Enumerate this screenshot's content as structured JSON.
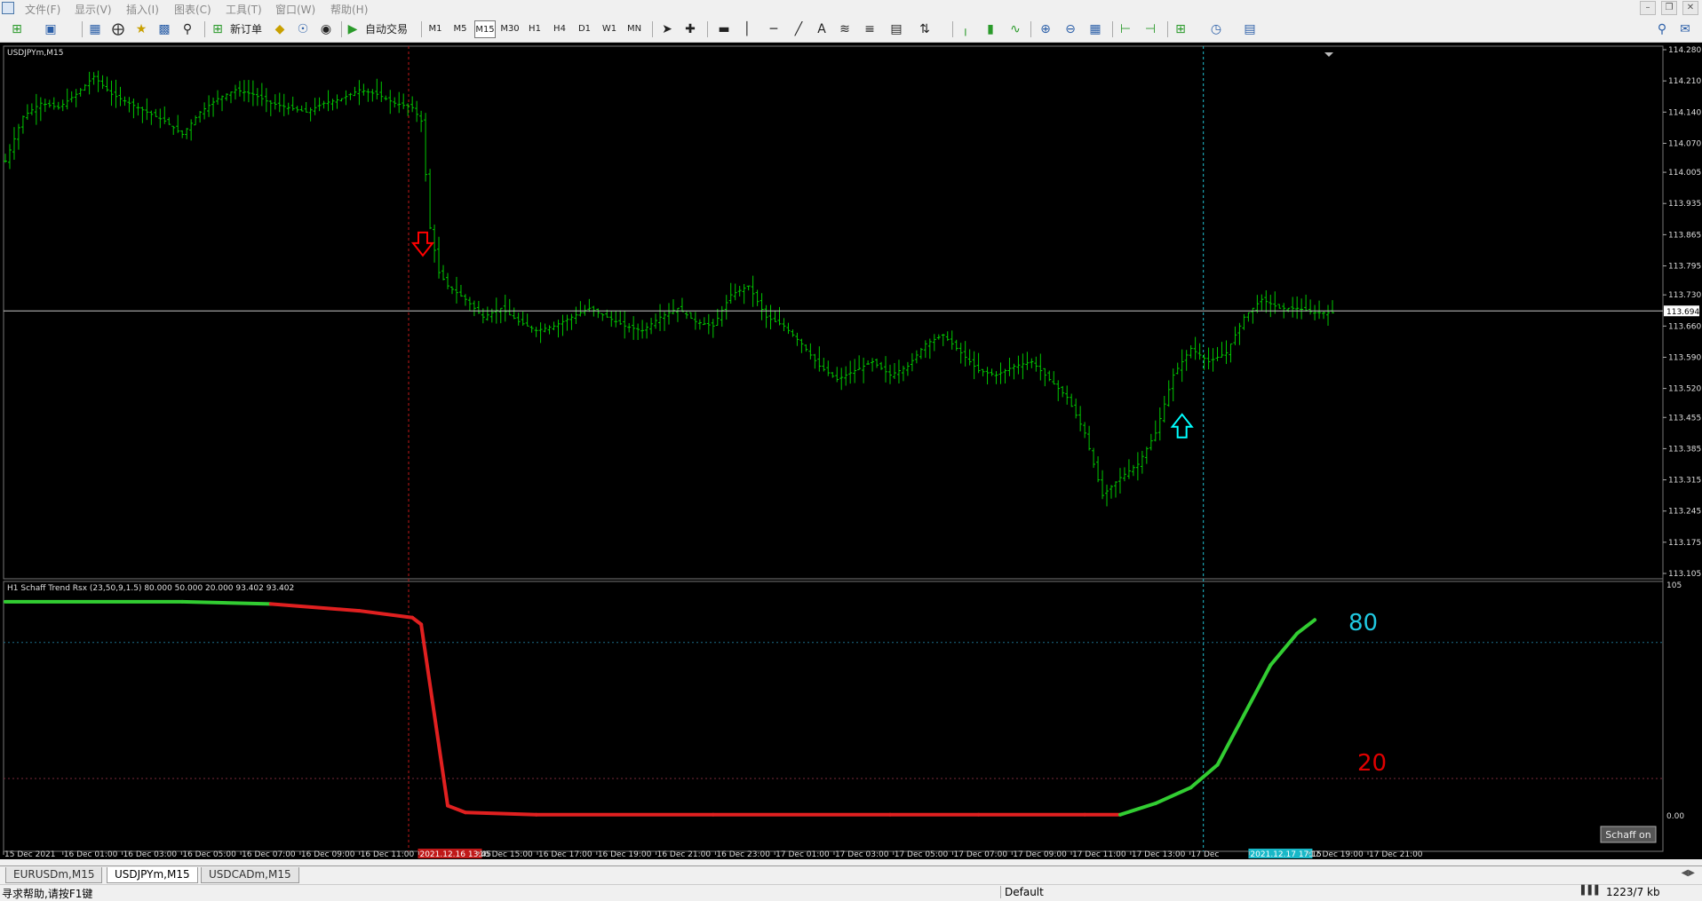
{
  "menu": [
    "文件(F)",
    "显示(V)",
    "插入(I)",
    "图表(C)",
    "工具(T)",
    "窗口(W)",
    "帮助(H)"
  ],
  "toolbar": {
    "new_order": "新订单",
    "auto_trading": "自动交易",
    "timeframes": [
      "M1",
      "M5",
      "M15",
      "M30",
      "H1",
      "H4",
      "D1",
      "W1",
      "MN"
    ],
    "active_timeframe": "M15"
  },
  "chart": {
    "symbol_label": "USDJPYm,M15",
    "current_price": "113.694",
    "price_ticks": [
      "114.280",
      "114.210",
      "114.140",
      "114.070",
      "114.005",
      "113.935",
      "113.865",
      "113.795",
      "113.730",
      "113.660",
      "113.590",
      "113.520",
      "113.455",
      "113.385",
      "113.315",
      "113.245",
      "113.175",
      "113.105"
    ],
    "time_labels": [
      "15 Dec 2021",
      "16 Dec 01:00",
      "16 Dec 03:00",
      "16 Dec 05:00",
      "16 Dec 07:00",
      "16 Dec 09:00",
      "16 Dec 11:00",
      "2021.12.16 13:45",
      "16 Dec 15:00",
      "16 Dec 17:00",
      "16 Dec 19:00",
      "16 Dec 21:00",
      "16 Dec 23:00",
      "17 Dec 01:00",
      "17 Dec 03:00",
      "17 Dec 05:00",
      "17 Dec 07:00",
      "17 Dec 09:00",
      "17 Dec 11:00",
      "17 Dec 13:00",
      "17 Dec",
      "2021.12.17 17:15",
      "17 Dec 19:00",
      "17 Dec 21:00"
    ],
    "sell_crosshair_time": "2021.12.16 13:45",
    "buy_crosshair_time": "2021.12.17 17:15",
    "colors": {
      "bars": "#00c800",
      "sell_arrow": "#ff0000",
      "buy_arrow": "#00ffff",
      "price_line": "#c8c8c8",
      "indicator_up": "#32cd32",
      "indicator_down": "#e02020"
    }
  },
  "indicator": {
    "label": "H1 Schaff Trend Rsx (23,50,9,1.5) 80.000 50.000 20.000 93.402 93.402",
    "axis_top": "105",
    "axis_bottom": "0.00",
    "level_80_label": "80",
    "level_20_label": "20",
    "button_label": "Schaff on"
  },
  "tabs": [
    {
      "label": "EURUSDm,M15",
      "active": false
    },
    {
      "label": "USDJPYm,M15",
      "active": true
    },
    {
      "label": "USDCADm,M15",
      "active": false
    }
  ],
  "status": {
    "help": "寻求帮助,请按F1键",
    "profile": "Default",
    "traffic": "1223/7 kb"
  },
  "chart_data": {
    "type": "line",
    "title": "",
    "series": [
      {
        "name": "",
        "values": [
          [
            0,
            114.03
          ],
          [
            2,
            114.13
          ],
          [
            4,
            114.16
          ],
          [
            6,
            114.15
          ],
          [
            8,
            114.18
          ],
          [
            10,
            114.22
          ],
          [
            12,
            114.18
          ],
          [
            14,
            114.16
          ],
          [
            16,
            114.14
          ],
          [
            18,
            114.12
          ],
          [
            20,
            114.09
          ],
          [
            22,
            114.14
          ],
          [
            24,
            114.17
          ],
          [
            26,
            114.19
          ],
          [
            28,
            114.18
          ],
          [
            30,
            114.16
          ],
          [
            32,
            114.15
          ],
          [
            34,
            114.14
          ],
          [
            36,
            114.16
          ],
          [
            38,
            114.17
          ],
          [
            40,
            114.19
          ],
          [
            42,
            114.18
          ],
          [
            44,
            114.16
          ],
          [
            46,
            114.15
          ],
          [
            47,
            114.12
          ],
          [
            48,
            113.88
          ],
          [
            49,
            113.78
          ],
          [
            50,
            113.75
          ],
          [
            52,
            113.72
          ],
          [
            54,
            113.68
          ],
          [
            56,
            113.7
          ],
          [
            58,
            113.67
          ],
          [
            60,
            113.65
          ],
          [
            62,
            113.66
          ],
          [
            64,
            113.68
          ],
          [
            66,
            113.7
          ],
          [
            68,
            113.68
          ],
          [
            70,
            113.66
          ],
          [
            72,
            113.65
          ],
          [
            74,
            113.68
          ],
          [
            76,
            113.7
          ],
          [
            78,
            113.67
          ],
          [
            80,
            113.66
          ],
          [
            82,
            113.73
          ],
          [
            84,
            113.75
          ],
          [
            86,
            113.68
          ],
          [
            88,
            113.66
          ],
          [
            90,
            113.62
          ],
          [
            92,
            113.57
          ],
          [
            94,
            113.54
          ],
          [
            96,
            113.56
          ],
          [
            98,
            113.58
          ],
          [
            100,
            113.55
          ],
          [
            102,
            113.57
          ],
          [
            104,
            113.62
          ],
          [
            106,
            113.64
          ],
          [
            108,
            113.6
          ],
          [
            110,
            113.56
          ],
          [
            112,
            113.55
          ],
          [
            114,
            113.57
          ],
          [
            116,
            113.58
          ],
          [
            118,
            113.54
          ],
          [
            120,
            113.5
          ],
          [
            122,
            113.42
          ],
          [
            124,
            113.28
          ],
          [
            126,
            113.32
          ],
          [
            128,
            113.35
          ],
          [
            130,
            113.42
          ],
          [
            132,
            113.55
          ],
          [
            134,
            113.61
          ],
          [
            136,
            113.58
          ],
          [
            138,
            113.6
          ],
          [
            140,
            113.68
          ],
          [
            142,
            113.72
          ],
          [
            144,
            113.7
          ],
          [
            146,
            113.7
          ],
          [
            148,
            113.69
          ],
          [
            150,
            113.69
          ]
        ]
      },
      {
        "name": "",
        "values": [
          [
            0,
            98
          ],
          [
            20,
            98
          ],
          [
            30,
            97
          ],
          [
            40,
            94
          ],
          [
            46,
            91
          ],
          [
            47,
            88
          ],
          [
            50,
            8
          ],
          [
            52,
            5
          ],
          [
            60,
            4
          ],
          [
            80,
            4
          ],
          [
            100,
            4
          ],
          [
            110,
            4
          ],
          [
            122,
            4
          ],
          [
            126,
            4
          ],
          [
            130,
            9
          ],
          [
            134,
            16
          ],
          [
            137,
            26
          ],
          [
            140,
            48
          ],
          [
            143,
            70
          ],
          [
            146,
            84
          ],
          [
            148,
            90
          ]
        ]
      }
    ],
    "ylim": [
      113.105,
      114.28
    ],
    "indicator_ylim": [
      0,
      105
    ],
    "levels": [
      80,
      20
    ],
    "signals": [
      {
        "type": "sell",
        "x": 50,
        "price": 113.85
      },
      {
        "type": "buy",
        "x": 133,
        "price": 113.43
      }
    ],
    "current_price": 113.694,
    "grid": false,
    "legend": "none"
  }
}
